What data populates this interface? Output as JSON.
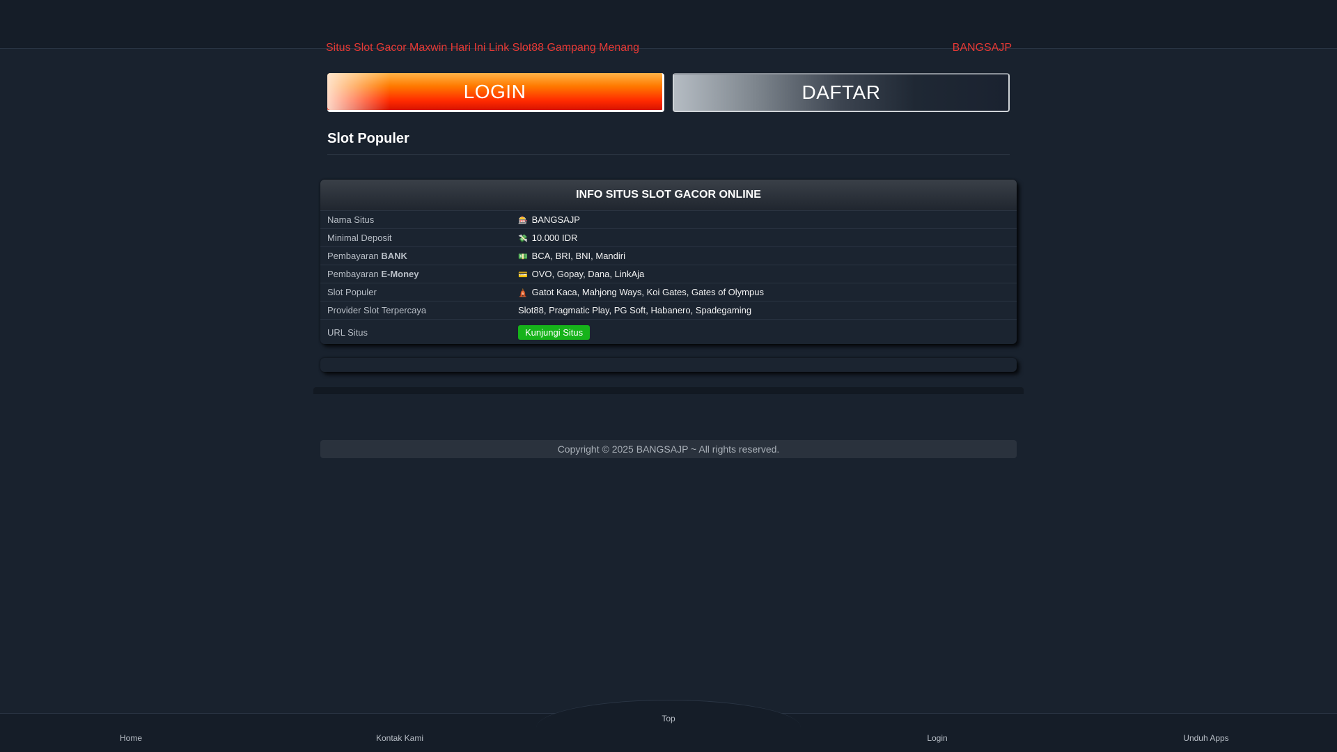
{
  "marquee": {
    "left_text": "Situs Slot Gacor Maxwin Hari Ini Link Slot88 Gampang Menang",
    "right_text": "BANGSAJP"
  },
  "buttons": {
    "login": "LOGIN",
    "daftar": "DAFTAR"
  },
  "section_title": "Slot Populer",
  "info": {
    "heading": "INFO SITUS SLOT GACOR ONLINE",
    "rows": [
      {
        "label": "Nama Situs",
        "value": "BANGSAJP",
        "icon": "slot-machine-icon",
        "glyph": "🎰"
      },
      {
        "label": "Minimal Deposit",
        "value": "10.000 IDR",
        "icon": "money-wings-icon",
        "glyph": "💸"
      },
      {
        "label_plain": "Pembayaran ",
        "label_bold": "BANK",
        "value": "BCA, BRI, BNI, Mandiri",
        "icon": "bank-icon",
        "glyph": "💵"
      },
      {
        "label_plain": "Pembayaran ",
        "label_bold": "E-Money",
        "value": "OVO, Gopay, Dana, LinkAja",
        "icon": "credit-card-icon",
        "glyph": "💳"
      },
      {
        "label": "Slot Populer",
        "value": "Gatot Kaca, Mahjong Ways, Koi Gates, Gates of Olympus",
        "icon": "temple-icon",
        "glyph": "🛕"
      },
      {
        "label": "Provider Slot Terpercaya",
        "value": "Slot88, Pragmatic Play, PG Soft, Habanero, Spadegaming"
      },
      {
        "label": "URL Situs",
        "button": "Kunjungi Situs"
      }
    ]
  },
  "footer": {
    "copyright": "Copyright © 2025 BANGSAJP ~ All rights reserved."
  },
  "bottom_nav": {
    "top": "Top",
    "home": "Home",
    "kontak": "Kontak Kami",
    "login": "Login",
    "unduh": "Unduh Apps"
  },
  "colors": {
    "background": "#19222e",
    "accent_red": "#e53935",
    "visit_green": "#16b31a"
  }
}
